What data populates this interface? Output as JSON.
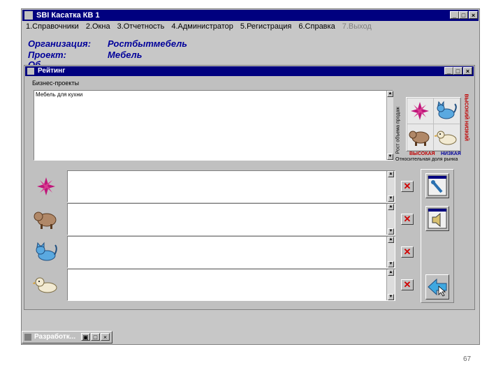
{
  "app": {
    "title": "SBI Касатка КВ 1",
    "menu": [
      {
        "label": "1.Справочники",
        "disabled": false
      },
      {
        "label": "2.Окна",
        "disabled": false
      },
      {
        "label": "3.Отчетность",
        "disabled": false
      },
      {
        "label": "4.Администратор",
        "disabled": false
      },
      {
        "label": "5.Регистрация",
        "disabled": false
      },
      {
        "label": "6.Справка",
        "disabled": false
      },
      {
        "label": "7.Выход",
        "disabled": true
      }
    ],
    "info": {
      "org_label": "Организация:",
      "org_value": "Ростбытмебель",
      "project_label": "Проект:",
      "project_value": "Мебель",
      "third_label": "Об"
    }
  },
  "rating": {
    "title": "Рейтинг",
    "section_label": "Бизнес-проекты",
    "list_item": "Мебель для кухни",
    "vertical_left": "Рост объема продаж",
    "vertical_right": "ВЫСОКИЙ НИЗКИЙ",
    "label_high": "ВЫСОКАЯ",
    "label_low": "НИЗКАЯ",
    "bottom_caption": "Относительная доля рынка"
  },
  "taskbar": {
    "label": "Разработк..."
  },
  "page_number": "67",
  "colors": {
    "title_blue": "#00007f",
    "info_text": "#00009a",
    "star_magenta": "#c0157a",
    "accent_red": "#d00000"
  },
  "icons": [
    "star-icon",
    "cat-icon",
    "cow-icon",
    "dog-icon",
    "remove-icon",
    "tool-icon",
    "speaker-icon",
    "back-arrow-icon"
  ]
}
